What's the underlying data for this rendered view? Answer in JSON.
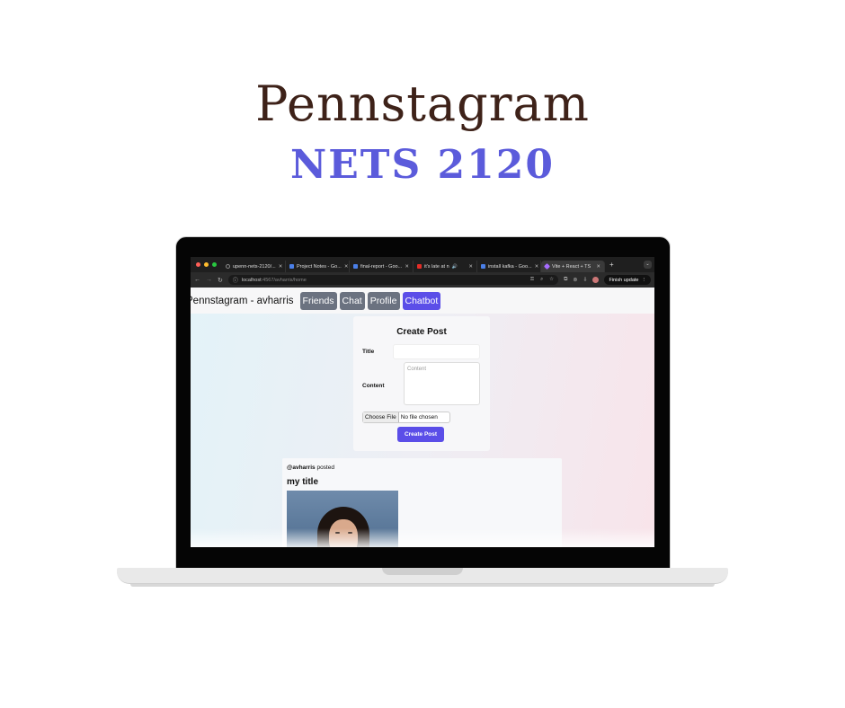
{
  "hero": {
    "title": "Pennstagram",
    "subtitle": "NETS 2120"
  },
  "browser": {
    "tabs": [
      {
        "label": "upenn-nets-2120/...",
        "favicon": "loading-icon",
        "color": "#888888"
      },
      {
        "label": "Project Notes - Go...",
        "favicon": "docs-icon",
        "color": "#4a7fe8"
      },
      {
        "label": "final-report - Goo...",
        "favicon": "docs-icon",
        "color": "#4a7fe8"
      },
      {
        "label": "it's late at n",
        "favicon": "youtube-icon",
        "color": "#e52d27"
      },
      {
        "label": "install kafka - Goo...",
        "favicon": "docs-icon",
        "color": "#4a7fe8"
      },
      {
        "label": "Vite + React + TS",
        "favicon": "vite-icon",
        "color": "#a66cff"
      }
    ],
    "tab_close": "✕",
    "new_tab": "+",
    "tab_menu": "⌄",
    "url_host": "localhost",
    "url_path": ":4567/avharris/home",
    "finish_update": "Finish update"
  },
  "navbar": {
    "brand": "Pennstagram - avharris",
    "buttons": {
      "friends": "Friends",
      "chat": "Chat",
      "profile": "Profile",
      "chatbot": "Chatbot"
    }
  },
  "create_post": {
    "heading": "Create Post",
    "title_label": "Title",
    "title_value": "",
    "content_label": "Content",
    "content_placeholder": "Content",
    "choose_file": "Choose File",
    "no_file": "No file chosen",
    "submit": "Create Post"
  },
  "post": {
    "author": "@avharris",
    "action": "posted",
    "title": "my title"
  },
  "colors": {
    "accent": "#5b4ee8",
    "nav_button": "#6b7280",
    "hero_title": "#3e2219",
    "hero_subtitle": "#5b5bdb"
  }
}
